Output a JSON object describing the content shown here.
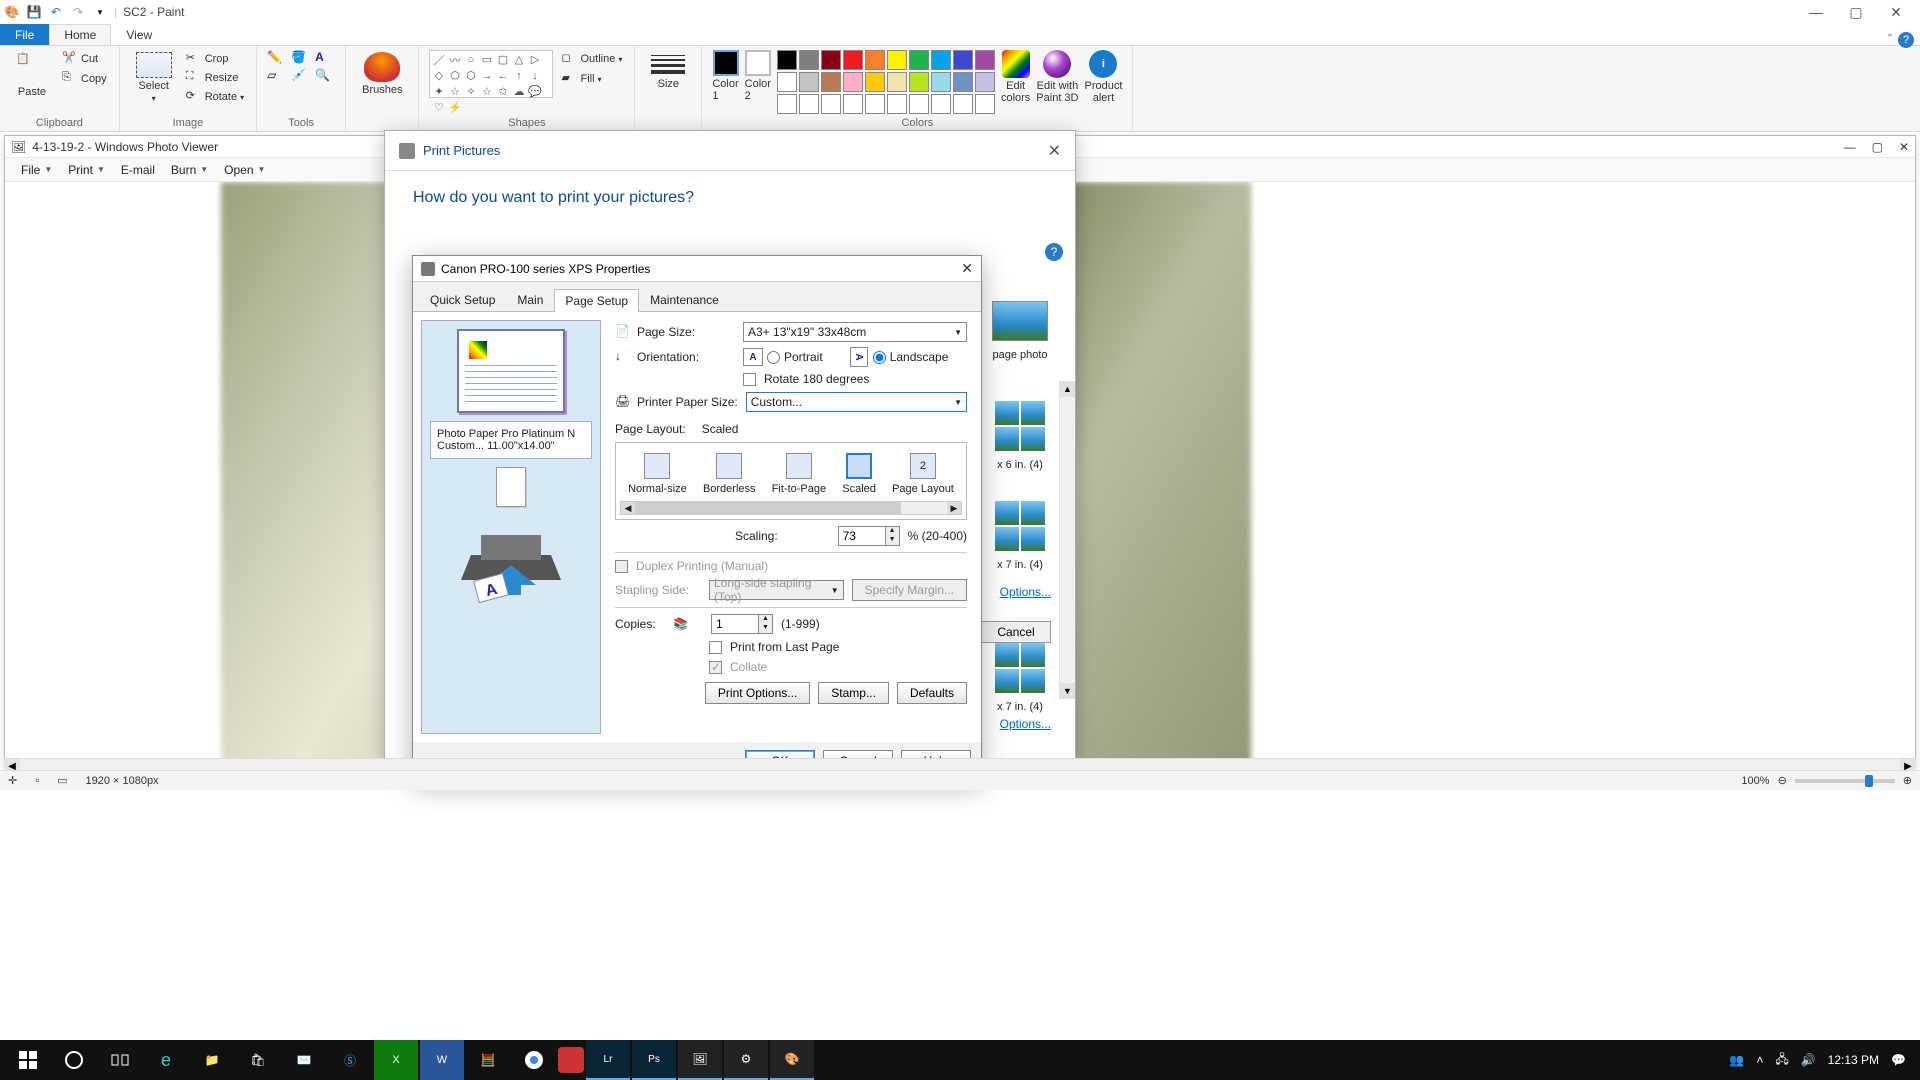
{
  "paint": {
    "title": "SC2 - Paint",
    "tabs": {
      "file": "File",
      "home": "Home",
      "view": "View"
    },
    "groups": {
      "clipboard": {
        "label": "Clipboard",
        "paste": "Paste",
        "cut": "Cut",
        "copy": "Copy"
      },
      "image": {
        "label": "Image",
        "select": "Select",
        "crop": "Crop",
        "resize": "Resize",
        "rotate": "Rotate"
      },
      "tools": {
        "label": "Tools"
      },
      "brushes": {
        "label": "Brushes"
      },
      "shapes": {
        "label": "Shapes",
        "outline": "Outline",
        "fill": "Fill"
      },
      "size": {
        "label": "Size"
      },
      "colors": {
        "label": "Colors",
        "c1": "Color\n1",
        "c2": "Color\n2",
        "edit": "Edit\ncolors",
        "p3d": "Edit with\nPaint 3D",
        "alert": "Product\nalert"
      }
    },
    "status": {
      "dims": "1920 × 1080px",
      "zoom": "100%"
    }
  },
  "photoviewer": {
    "title": "4-13-19-2 - Windows Photo Viewer",
    "menu": {
      "file": "File",
      "print": "Print",
      "email": "E-mail",
      "burn": "Burn",
      "open": "Open"
    }
  },
  "print_pics": {
    "title": "Print Pictures",
    "question": "How do you want to print your pictures?",
    "fullpage": "page photo",
    "l6": "x 6 in. (4)",
    "l7a": "x 7 in. (4)",
    "l7b": "x 7 in. (4)",
    "options": "Options...",
    "cancel": "Cancel"
  },
  "props": {
    "title": "Canon PRO-100 series XPS Properties",
    "tabs": {
      "quick": "Quick Setup",
      "main": "Main",
      "page": "Page Setup",
      "maint": "Maintenance"
    },
    "left": {
      "info1": "Photo Paper Pro Platinum N",
      "info2": "Custom... 11.00\"x14.00\""
    },
    "page_size": {
      "lbl": "Page Size:",
      "val": "A3+ 13\"x19\" 33x48cm"
    },
    "orientation": {
      "lbl": "Orientation:",
      "portrait": "Portrait",
      "landscape": "Landscape",
      "rotate": "Rotate 180 degrees"
    },
    "paper": {
      "lbl": "Printer Paper Size:",
      "val": "Custom..."
    },
    "layout": {
      "lbl": "Page Layout:",
      "sel": "Scaled",
      "opts": [
        "Normal-size",
        "Borderless",
        "Fit-to-Page",
        "Scaled",
        "Page Layout"
      ]
    },
    "scaling": {
      "lbl": "Scaling:",
      "val": "73",
      "range": "% (20-400)"
    },
    "duplex": {
      "lbl": "Duplex Printing (Manual)",
      "stapling": "Stapling Side:",
      "stapling_val": "Long-side stapling (Top)",
      "margin": "Specify Margin..."
    },
    "copies": {
      "lbl": "Copies:",
      "val": "1",
      "range": "(1-999)",
      "fromlast": "Print from Last Page",
      "collate": "Collate"
    },
    "buttons": {
      "printopt": "Print Options...",
      "stamp": "Stamp...",
      "defaults": "Defaults",
      "ok": "OK",
      "cancel": "Cancel",
      "help": "Help"
    }
  },
  "taskbar": {
    "time": "12:13 PM"
  }
}
